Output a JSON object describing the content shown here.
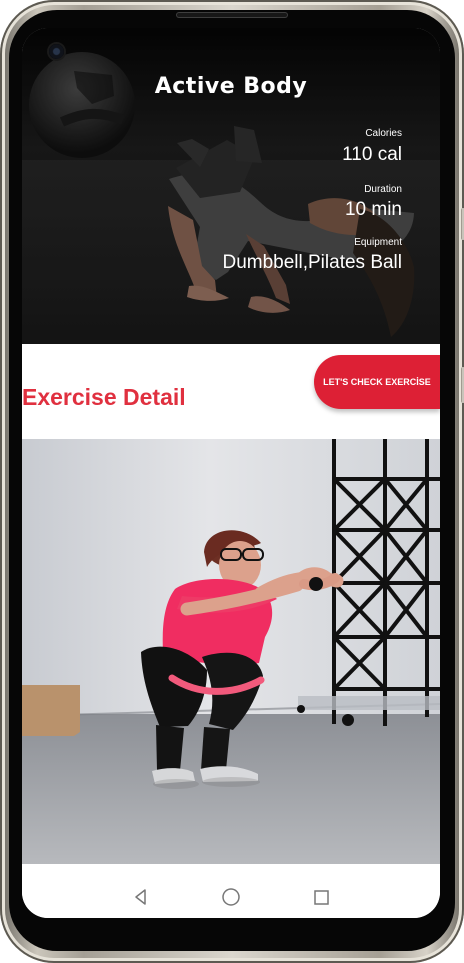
{
  "app": {
    "title": "Active Body"
  },
  "stats": [
    {
      "label": "Calories",
      "value": "110 cal"
    },
    {
      "label": "Duration",
      "value": "10 min"
    },
    {
      "label": "Equipment",
      "value": "Dumbbell,Pilates Ball"
    }
  ],
  "section": {
    "title": "Exercise Detail",
    "button_label": "LET'S CHECK EXERCİSE"
  },
  "navigation": [
    {
      "icon": "back-triangle-icon"
    },
    {
      "icon": "home-circle-icon"
    },
    {
      "icon": "recent-apps-square-icon"
    }
  ],
  "colors": {
    "accent_red": "#e0303f",
    "button_red": "#dd2035",
    "hero_dark": "#101010",
    "exercise_shirt": "#f02d61",
    "phone_frame": "#d8d2c7"
  }
}
